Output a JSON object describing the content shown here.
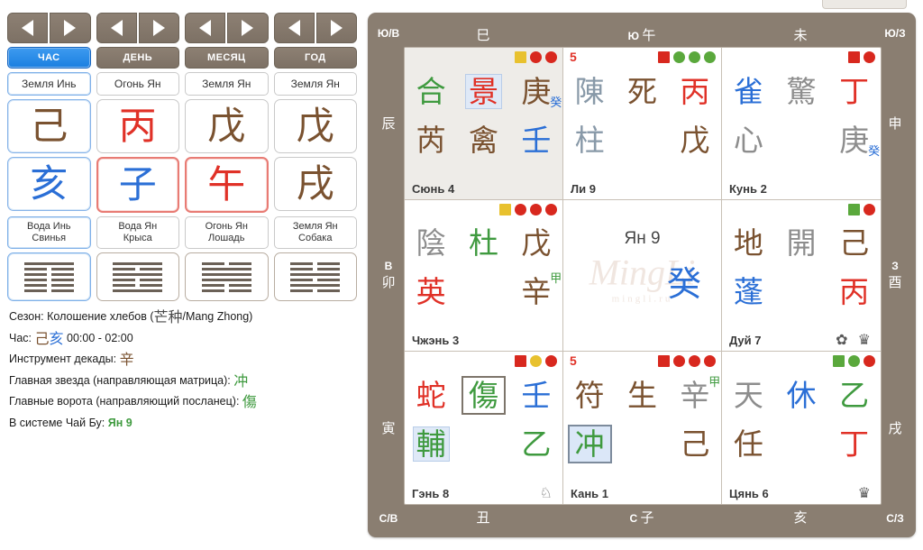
{
  "left": {
    "pillars": [
      {
        "nav": {
          "prev": "◀",
          "next": "▶"
        },
        "label": "ЧАС",
        "active": true,
        "element": "Земля Инь",
        "stem": "己",
        "stem_color": "#7a5230",
        "branch": "亥",
        "branch_color": "#2b6fd6",
        "name_line1": "Вода Инь",
        "name_line2": "Свинья",
        "hexagram": [
          "yang",
          "yin",
          "yin",
          "yin",
          "yin",
          "yin"
        ]
      },
      {
        "nav": {
          "prev": "◀",
          "next": "▶"
        },
        "label": "ДЕНЬ",
        "active": false,
        "element": "Огонь Ян",
        "stem": "丙",
        "stem_color": "#e03127",
        "branch": "子",
        "branch_color": "#2b6fd6",
        "name_line1": "Вода Ян",
        "name_line2": "Крыса",
        "hexagram": [
          "yang",
          "yin",
          "yang",
          "yin",
          "yin",
          "yang"
        ]
      },
      {
        "nav": {
          "prev": "◀",
          "next": "▶"
        },
        "label": "МЕСЯЦ",
        "active": false,
        "element": "Земля Ян",
        "stem": "戊",
        "stem_color": "#7a5230",
        "branch": "午",
        "branch_color": "#e03127",
        "name_line1": "Огонь Ян",
        "name_line2": "Лошадь",
        "hexagram": [
          "yin",
          "yang",
          "yang",
          "yang",
          "yin",
          "yin"
        ]
      },
      {
        "nav": {
          "prev": "◀",
          "next": "▶"
        },
        "label": "ГОД",
        "active": false,
        "element": "Земля Ян",
        "stem": "戊",
        "stem_color": "#7a5230",
        "branch": "戌",
        "branch_color": "#7a5230",
        "name_line1": "Земля Ян",
        "name_line2": "Собака",
        "hexagram": [
          "yin",
          "yin",
          "yang",
          "yin",
          "yang",
          "yin"
        ]
      }
    ],
    "info": {
      "season_label": "Сезон:",
      "season_value": "Колошение хлебов (",
      "season_han": "芒种",
      "season_value_tail": "/Mang Zhong)",
      "hour_label": "Час:",
      "hour_stem": "己",
      "hour_branch": "亥",
      "hour_range": "00:00 - 02:00",
      "decade_label": "Инструмент декады:",
      "decade_value": "辛",
      "star_label": "Главная звезда (направляющая матрица):",
      "star_value": "冲",
      "gate_label": "Главные ворота (направляющий посланец):",
      "gate_value": "傷",
      "chaibu_label": "В системе Чай Бу:",
      "chaibu_value": "Ян 9"
    }
  },
  "chart": {
    "edges": {
      "top_left_corner": "Ю/В",
      "top_right_corner": "Ю/З",
      "bottom_left_corner": "С/В",
      "bottom_right_corner": "С/З",
      "top": [
        {
          "text": "巳"
        },
        {
          "prefix": "Ю",
          "text": "午"
        },
        {
          "text": "未"
        }
      ],
      "bottom": [
        {
          "text": "丑"
        },
        {
          "prefix": "С",
          "text": "子"
        },
        {
          "text": "亥"
        }
      ],
      "left": [
        {
          "text": "辰"
        },
        {
          "prefix": "В",
          "text": "卯"
        },
        {
          "text": "寅"
        }
      ],
      "right": [
        {
          "text": "申"
        },
        {
          "prefix": "З",
          "text": "酉"
        },
        {
          "text": "戌"
        }
      ]
    },
    "watermark": "MingLi",
    "watermark_sub": "mingli.ru",
    "cells": [
      {
        "palace": "Сюнь 4",
        "tinted": true,
        "five": "",
        "markers": [
          {
            "shape": "square",
            "color": "#e8c12e"
          },
          {
            "shape": "circle",
            "color": "#d8281e"
          },
          {
            "shape": "circle",
            "color": "#d8281e"
          }
        ],
        "rowA": [
          {
            "ch": "合",
            "color": "#3f9a3f"
          },
          {
            "ch": "景",
            "color": "#e03127",
            "style": "hl"
          },
          {
            "ch": "庚",
            "color": "#7a5230",
            "sub": "癸",
            "sub_color": "#2b6fd6"
          }
        ],
        "rowB": [
          {
            "ch": "芮",
            "color": "#7a5230"
          },
          {
            "ch": "禽",
            "color": "#7a5230"
          },
          {
            "ch": "壬",
            "color": "#2b6fd6"
          }
        ],
        "marks": ""
      },
      {
        "palace": "Ли 9",
        "tinted": false,
        "five": "5",
        "markers": [
          {
            "shape": "square",
            "color": "#d8281e"
          },
          {
            "shape": "circle",
            "color": "#5aa83c"
          },
          {
            "shape": "circle",
            "color": "#5aa83c"
          },
          {
            "shape": "circle",
            "color": "#5aa83c"
          }
        ],
        "rowA": [
          {
            "ch": "陳",
            "color": "#8899a8"
          },
          {
            "ch": "死",
            "color": "#7a5230"
          },
          {
            "ch": "丙",
            "color": "#e03127"
          }
        ],
        "rowB": [
          {
            "ch": "柱",
            "color": "#8899a8"
          },
          {
            "ch": "",
            "color": "#000000"
          },
          {
            "ch": "戊",
            "color": "#7a5230"
          }
        ],
        "marks": ""
      },
      {
        "palace": "Кунь 2",
        "tinted": false,
        "five": "",
        "markers": [
          {
            "shape": "square",
            "color": "#d8281e"
          },
          {
            "shape": "circle",
            "color": "#d8281e"
          }
        ],
        "rowA": [
          {
            "ch": "雀",
            "color": "#2b6fd6"
          },
          {
            "ch": "驚",
            "color": "#8d8d8d"
          },
          {
            "ch": "丁",
            "color": "#e03127"
          }
        ],
        "rowB": [
          {
            "ch": "心",
            "color": "#8d8d8d"
          },
          {
            "ch": "",
            "color": "#000000"
          },
          {
            "ch": "庚",
            "color": "#8d8d8d",
            "sub": "癸",
            "sub_color": "#2b6fd6"
          }
        ],
        "marks": ""
      },
      {
        "palace": "Чжэнь 3",
        "tinted": false,
        "five": "",
        "markers": [
          {
            "shape": "square",
            "color": "#e8c12e"
          },
          {
            "shape": "circle",
            "color": "#d8281e"
          },
          {
            "shape": "circle",
            "color": "#d8281e"
          },
          {
            "shape": "circle",
            "color": "#d8281e"
          }
        ],
        "rowA": [
          {
            "ch": "陰",
            "color": "#8d8d8d"
          },
          {
            "ch": "杜",
            "color": "#3f9a3f"
          },
          {
            "ch": "戊",
            "color": "#7a5230"
          }
        ],
        "rowB": [
          {
            "ch": "英",
            "color": "#e03127"
          },
          {
            "ch": "",
            "color": "#000000"
          },
          {
            "ch": "辛",
            "color": "#7a5230",
            "sub": "甲",
            "sub_color": "#3f9a3f",
            "sub_up": true
          }
        ],
        "marks": ""
      },
      {
        "palace": "",
        "tinted": false,
        "five": "",
        "markers": [],
        "center_label": "Ян 9",
        "center_ch": "癸",
        "center_color": "#2b6fd6",
        "rowA": [],
        "rowB": [],
        "marks": ""
      },
      {
        "palace": "Дуй 7",
        "tinted": false,
        "five": "",
        "markers": [
          {
            "shape": "square",
            "color": "#5aa83c"
          },
          {
            "shape": "circle",
            "color": "#d8281e"
          }
        ],
        "rowA": [
          {
            "ch": "地",
            "color": "#7a5230"
          },
          {
            "ch": "開",
            "color": "#8d8d8d"
          },
          {
            "ch": "己",
            "color": "#7a5230"
          }
        ],
        "rowB": [
          {
            "ch": "蓬",
            "color": "#2b6fd6"
          },
          {
            "ch": "",
            "color": "#000000"
          },
          {
            "ch": "丙",
            "color": "#e03127"
          }
        ],
        "marks": "✿ ♛"
      },
      {
        "palace": "Гэнь 8",
        "tinted": false,
        "five": "",
        "markers": [
          {
            "shape": "square",
            "color": "#d8281e"
          },
          {
            "shape": "circle",
            "color": "#e8c12e"
          },
          {
            "shape": "circle",
            "color": "#d8281e"
          }
        ],
        "rowA": [
          {
            "ch": "蛇",
            "color": "#e03127"
          },
          {
            "ch": "傷",
            "color": "#3f9a3f",
            "style": "boxed"
          },
          {
            "ch": "壬",
            "color": "#2b6fd6"
          }
        ],
        "rowB": [
          {
            "ch": "輔",
            "color": "#3f9a3f",
            "style": "hl"
          },
          {
            "ch": "",
            "color": "#000000"
          },
          {
            "ch": "乙",
            "color": "#3f9a3f"
          }
        ],
        "marks": "♘"
      },
      {
        "palace": "Кань 1",
        "tinted": false,
        "five": "5",
        "markers": [
          {
            "shape": "square",
            "color": "#d8281e"
          },
          {
            "shape": "circle",
            "color": "#d8281e"
          },
          {
            "shape": "circle",
            "color": "#d8281e"
          },
          {
            "shape": "circle",
            "color": "#d8281e"
          }
        ],
        "rowA": [
          {
            "ch": "符",
            "color": "#7a5230"
          },
          {
            "ch": "生",
            "color": "#7a5230"
          },
          {
            "ch": "辛",
            "color": "#8d8d8d",
            "sub": "甲",
            "sub_color": "#3f9a3f",
            "sub_up": true
          }
        ],
        "rowB": [
          {
            "ch": "冲",
            "color": "#3f9a3f",
            "style": "hlbox"
          },
          {
            "ch": "",
            "color": "#000000"
          },
          {
            "ch": "己",
            "color": "#7a5230"
          }
        ],
        "marks": ""
      },
      {
        "palace": "Цянь 6",
        "tinted": false,
        "five": "",
        "markers": [
          {
            "shape": "square",
            "color": "#5aa83c"
          },
          {
            "shape": "circle",
            "color": "#5aa83c"
          },
          {
            "shape": "circle",
            "color": "#d8281e"
          }
        ],
        "rowA": [
          {
            "ch": "天",
            "color": "#8d8d8d"
          },
          {
            "ch": "休",
            "color": "#2b6fd6"
          },
          {
            "ch": "乙",
            "color": "#3f9a3f"
          }
        ],
        "rowB": [
          {
            "ch": "任",
            "color": "#7a5230"
          },
          {
            "ch": "",
            "color": "#000000"
          },
          {
            "ch": "丁",
            "color": "#e03127"
          }
        ],
        "marks": "♛"
      }
    ]
  }
}
